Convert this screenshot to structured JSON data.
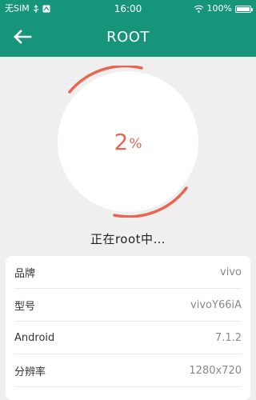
{
  "status_bar": {
    "carrier": "无SIM",
    "time": "16:00",
    "battery": "100%"
  },
  "header": {
    "title": "ROOT"
  },
  "progress": {
    "value": "2",
    "unit": "%",
    "fraction": 0.02,
    "status": "正在root中…"
  },
  "device_info": [
    {
      "label": "品牌",
      "value": "vivo"
    },
    {
      "label": "型号",
      "value": "vivoY66iA"
    },
    {
      "label": "Android",
      "value": "7.1.2"
    },
    {
      "label": "分辨率",
      "value": "1280x720"
    }
  ],
  "colors": {
    "header": "#16957a",
    "accent": "#e8664f",
    "background": "#efefef"
  }
}
